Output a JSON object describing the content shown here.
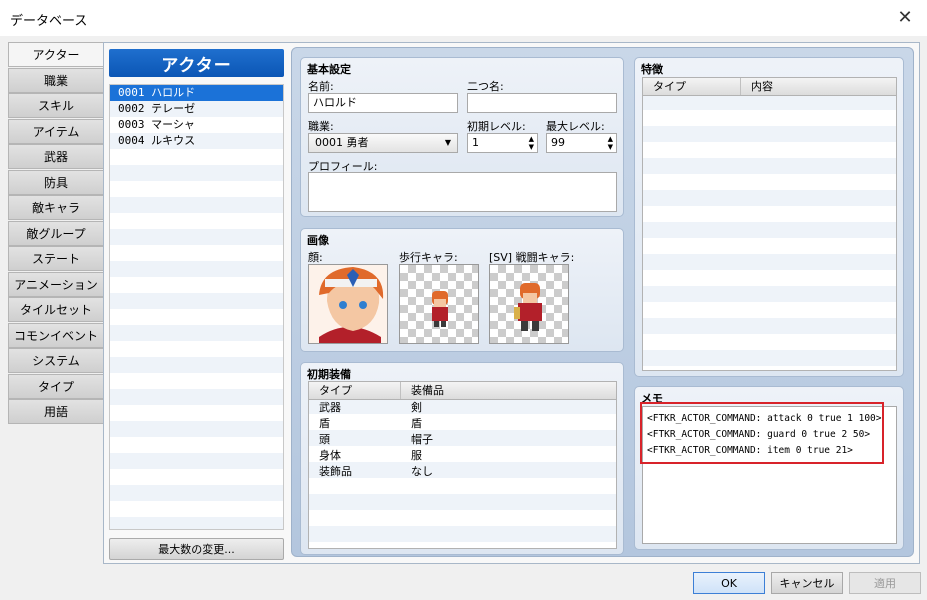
{
  "window": {
    "title": "データベース",
    "close_icon": "close-icon"
  },
  "tabs": [
    "アクター",
    "職業",
    "スキル",
    "アイテム",
    "武器",
    "防具",
    "敵キャラ",
    "敵グループ",
    "ステート",
    "アニメーション",
    "タイルセット",
    "コモンイベント",
    "システム",
    "タイプ",
    "用語"
  ],
  "actors": {
    "header": "アクター",
    "items": [
      "0001 ハロルド",
      "0002 テレーゼ",
      "0003 マーシャ",
      "0004 ルキウス"
    ],
    "max_button": "最大数の変更..."
  },
  "basic": {
    "title": "基本設定",
    "name_label": "名前:",
    "name_value": "ハロルド",
    "nickname_label": "二つ名:",
    "nickname_value": "",
    "class_label": "職業:",
    "class_value": "0001 勇者",
    "init_level_label": "初期レベル:",
    "init_level_value": "1",
    "max_level_label": "最大レベル:",
    "max_level_value": "99",
    "profile_label": "プロフィール:"
  },
  "images": {
    "title": "画像",
    "face_label": "顔:",
    "walk_label": "歩行キャラ:",
    "sv_label": "[SV] 戦闘キャラ:"
  },
  "equipment": {
    "title": "初期装備",
    "headers": [
      "タイプ",
      "装備品"
    ],
    "rows": [
      [
        "武器",
        "剣"
      ],
      [
        "盾",
        "盾"
      ],
      [
        "頭",
        "帽子"
      ],
      [
        "身体",
        "服"
      ],
      [
        "装飾品",
        "なし"
      ]
    ]
  },
  "traits": {
    "title": "特徴",
    "headers": [
      "タイプ",
      "内容"
    ]
  },
  "memo": {
    "title": "メモ",
    "lines": [
      "<FTKR_ACTOR_COMMAND: attack 0 true 1 100>",
      "<FTKR_ACTOR_COMMAND: guard 0 true 2 50>",
      "<FTKR_ACTOR_COMMAND: item 0 true 21>"
    ]
  },
  "buttons": {
    "ok": "OK",
    "cancel": "キャンセル",
    "apply": "適用"
  }
}
